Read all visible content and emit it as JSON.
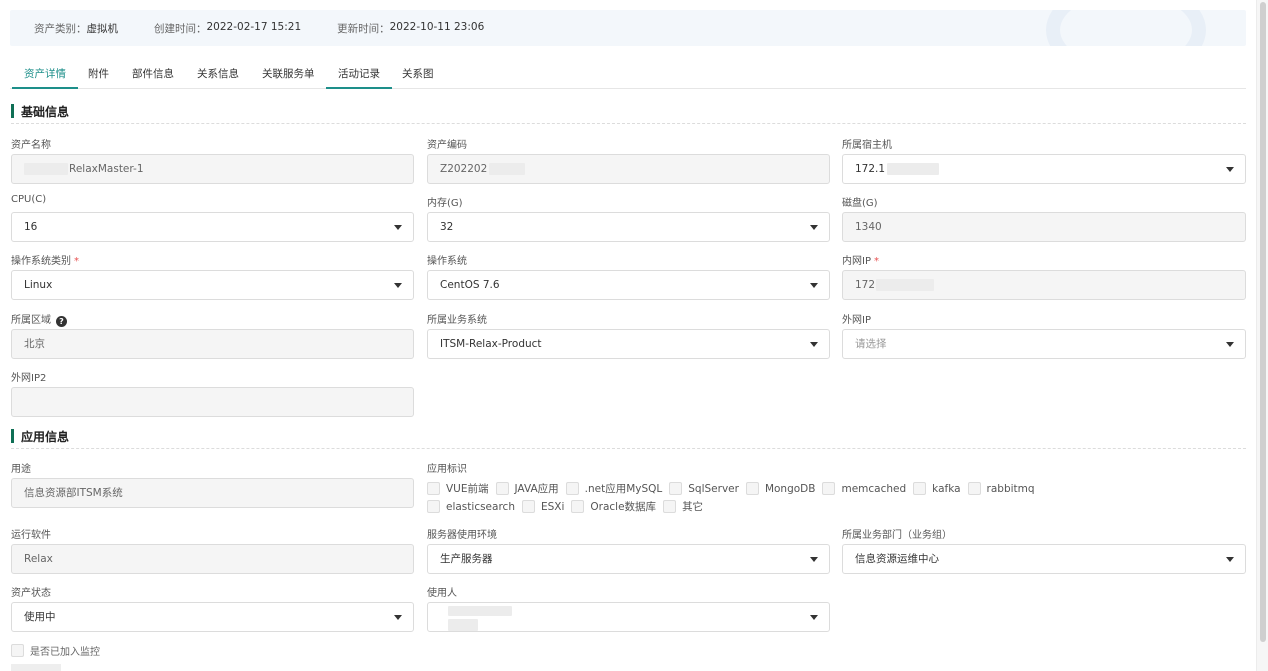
{
  "header": {
    "asset_type_label": "资产类别：",
    "asset_type_value": "虚拟机",
    "created_label": "创建时间：",
    "created_value": "2022-02-17 15:21",
    "updated_label": "更新时间：",
    "updated_value": "2022-10-11 23:06"
  },
  "tabs": [
    {
      "label": "资产详情"
    },
    {
      "label": "附件"
    },
    {
      "label": "部件信息"
    },
    {
      "label": "关系信息"
    },
    {
      "label": "关联服务单"
    },
    {
      "label": "活动记录"
    },
    {
      "label": "关系图"
    }
  ],
  "basic": {
    "title": "基础信息",
    "asset_name": {
      "label": "资产名称",
      "value": "RelaxMaster-1"
    },
    "asset_code": {
      "label": "资产编码",
      "value": "Z202202"
    },
    "host": {
      "label": "所属宿主机",
      "value": "172.1"
    },
    "cpu": {
      "label": "CPU(C)",
      "value": "16"
    },
    "memory": {
      "label": "内存(G)",
      "value": "32"
    },
    "disk": {
      "label": "磁盘(G)",
      "value": "1340"
    },
    "os_type": {
      "label": "操作系统类别",
      "value": "Linux",
      "required": "*"
    },
    "os": {
      "label": "操作系统",
      "value": "CentOS 7.6"
    },
    "intranet_ip": {
      "label": "内网IP",
      "value": "172",
      "required": "*"
    },
    "region": {
      "label": "所属区域",
      "value": "北京"
    },
    "business_system": {
      "label": "所属业务系统",
      "value": "ITSM-Relax-Product"
    },
    "extranet_ip": {
      "label": "外网IP",
      "placeholder": "请选择"
    },
    "extranet_ip2": {
      "label": "外网IP2",
      "value": ""
    }
  },
  "app": {
    "title": "应用信息",
    "purpose": {
      "label": "用途",
      "value": "信息资源部ITSM系统"
    },
    "app_tags": {
      "label": "应用标识",
      "options": [
        "VUE前端",
        "JAVA应用",
        ".net应用MySQL",
        "SqlServer",
        "MongoDB",
        "memcached",
        "kafka",
        "rabbitmq",
        "elasticsearch",
        "ESXi",
        "Oracle数据库",
        "其它"
      ]
    },
    "software": {
      "label": "运行软件",
      "value": "Relax"
    },
    "environment": {
      "label": "服务器使用环境",
      "value": "生产服务器"
    },
    "department": {
      "label": "所属业务部门（业务组）",
      "value": "信息资源运维中心"
    },
    "status": {
      "label": "资产状态",
      "value": "使用中"
    },
    "user": {
      "label": "使用人",
      "value": ""
    },
    "monitor": {
      "label": "是否已加入监控"
    }
  },
  "icons": {
    "help": "question-circle-icon",
    "caret": "caret-down-icon"
  },
  "colors": {
    "accent": "#1d8f8a",
    "section_bar": "#0f6f55",
    "required": "#e85050"
  }
}
